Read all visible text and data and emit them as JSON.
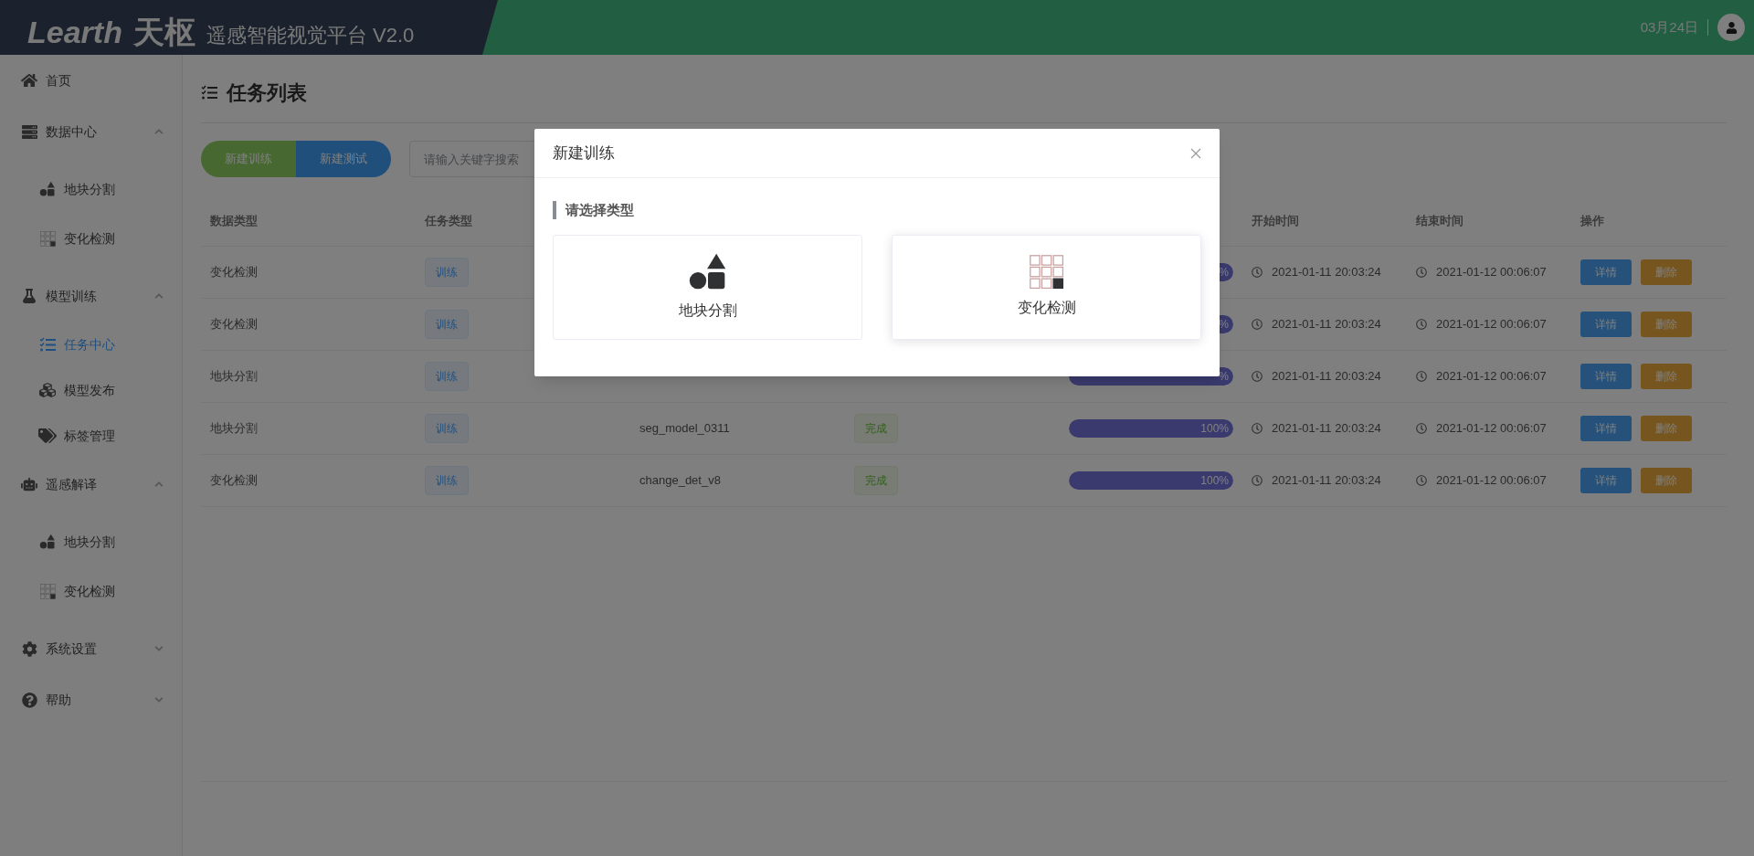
{
  "header": {
    "logo": "Learth",
    "logo_cn": "天枢",
    "subtitle": "遥感智能视觉平台 V2.0",
    "date": "03月24日"
  },
  "sidebar": {
    "items": [
      {
        "label": "首页",
        "selected": false
      },
      {
        "label": "数据中心",
        "selected": false,
        "expanded": true,
        "children": [
          {
            "label": "地块分割",
            "selected": false
          },
          {
            "label": "变化检测",
            "selected": false
          }
        ]
      },
      {
        "label": "模型训练",
        "selected": false,
        "expanded": true,
        "children": [
          {
            "label": "任务中心",
            "selected": true
          },
          {
            "label": "模型发布",
            "selected": false
          },
          {
            "label": "标签管理",
            "selected": false
          }
        ]
      },
      {
        "label": "遥感解译",
        "selected": false,
        "expanded": true,
        "children": [
          {
            "label": "地块分割",
            "selected": false
          },
          {
            "label": "变化检测",
            "selected": false
          }
        ]
      },
      {
        "label": "系统设置",
        "selected": false,
        "expanded": false
      },
      {
        "label": "帮助",
        "selected": false,
        "expanded": false
      }
    ]
  },
  "page": {
    "title": "任务列表",
    "buttons": [
      {
        "label": "新建训练",
        "kind": "train"
      },
      {
        "label": "新建测试",
        "kind": "test"
      }
    ],
    "search": {
      "placeholder": "请输入关键字搜索"
    }
  },
  "table": {
    "columns": {
      "data_type": "数据类型",
      "task_type": "任务类型",
      "start": "开始时间",
      "end": "结束时间",
      "actions": "操作"
    },
    "rows": [
      {
        "data_type": "变化检测",
        "task_type": "训练",
        "progress": {
          "level": 1,
          "reading": "%"
        },
        "start": "2021-01-11 20:03:24",
        "end": "2021-01-12 00:06:07",
        "actions": [
          {
            "label": "详情",
            "kind": "detail"
          },
          {
            "label": "删除",
            "kind": "delete"
          }
        ]
      },
      {
        "data_type": "变化检测",
        "task_type": "训练",
        "progress": {
          "level": 1,
          "reading": "%"
        },
        "start": "2021-01-11 20:03:24",
        "end": "2021-01-12 00:06:07",
        "actions": [
          {
            "label": "详情",
            "kind": "detail"
          },
          {
            "label": "删除",
            "kind": "delete"
          }
        ]
      },
      {
        "data_type": "地块分割",
        "task_type": "训练",
        "progress": {
          "level": 1,
          "reading": "%"
        },
        "start": "2021-01-11 20:03:24",
        "end": "2021-01-12 00:06:07",
        "actions": [
          {
            "label": "详情",
            "kind": "detail"
          },
          {
            "label": "删除",
            "kind": "delete"
          }
        ]
      },
      {
        "data_type": "地块分割",
        "task_type": "训练",
        "name": "seg_model_0311",
        "status": "完成",
        "progress": {
          "level": 1,
          "reading": "100%"
        },
        "start": "2021-01-11 20:03:24",
        "end": "2021-01-12 00:06:07",
        "actions": [
          {
            "label": "详情",
            "kind": "detail"
          },
          {
            "label": "删除",
            "kind": "delete"
          }
        ]
      },
      {
        "data_type": "变化检测",
        "task_type": "训练",
        "name": "change_det_v8",
        "status": "完成",
        "progress": {
          "level": 1,
          "reading": "100%"
        },
        "start": "2021-01-11 20:03:24",
        "end": "2021-01-12 00:06:07",
        "actions": [
          {
            "label": "详情",
            "kind": "detail"
          },
          {
            "label": "删除",
            "kind": "delete"
          }
        ]
      }
    ]
  },
  "dialog": {
    "title": "新建训练",
    "section": "请选择类型",
    "options": [
      {
        "label": "地块分割",
        "kind": "shapes",
        "selected": false
      },
      {
        "label": "变化检测",
        "kind": "grid",
        "selected": true
      }
    ]
  }
}
